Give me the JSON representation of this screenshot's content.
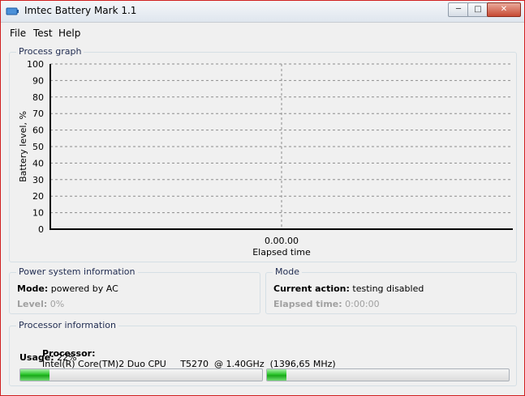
{
  "window": {
    "title": "Imtec Battery Mark 1.1"
  },
  "menu": {
    "items": [
      "File",
      "Test",
      "Help"
    ]
  },
  "process_graph": {
    "group_title": "Process graph",
    "ylabel": "Battery level, %",
    "xlabel": "Elapsed time",
    "x_tick": "0.00.00"
  },
  "chart_data": {
    "type": "line",
    "title": "",
    "xlabel": "Elapsed time",
    "ylabel": "Battery level, %",
    "y_ticks": [
      100,
      90,
      80,
      70,
      60,
      50,
      40,
      30,
      20,
      10,
      0
    ],
    "x_ticks": [
      "0.00.00"
    ],
    "ylim": [
      0,
      100
    ],
    "grid": true,
    "series": []
  },
  "power": {
    "group_title": "Power system information",
    "mode_label": "Mode:",
    "mode_value": "powered by AC",
    "level_label": "Level:",
    "level_value": "0%"
  },
  "mode": {
    "group_title": "Mode",
    "action_label": "Current action:",
    "action_value": "testing disabled",
    "elapsed_label": "Elapsed time:",
    "elapsed_value": "0:00:00"
  },
  "processor": {
    "group_title": "Processor information",
    "proc_label": "Processor:",
    "proc_value": "Intel(R) Core(TM)2 Duo CPU     T5270  @ 1.40GHz  (1396,65 MHz)",
    "usage_label": "Usage:",
    "usage_value": "22%",
    "core_usage": [
      0.12,
      0.08
    ]
  }
}
